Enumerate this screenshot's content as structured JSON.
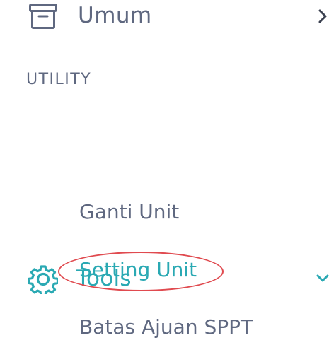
{
  "sidebar": {
    "items": [
      {
        "label": "Umum",
        "icon": "archive-icon",
        "expanded": false
      }
    ],
    "sections": [
      {
        "heading": "UTILITY",
        "menu": {
          "label": "Tools",
          "icon": "gear-icon",
          "expanded": true,
          "children": [
            {
              "label": "Ganti Unit",
              "active": false
            },
            {
              "label": "Setting Unit",
              "active": true
            },
            {
              "label": "Batas Ajuan SPPT",
              "active": false
            }
          ]
        }
      }
    ]
  },
  "colors": {
    "text_muted": "#5f6880",
    "accent": "#2aa9b3",
    "annotation": "#e04a4f"
  }
}
